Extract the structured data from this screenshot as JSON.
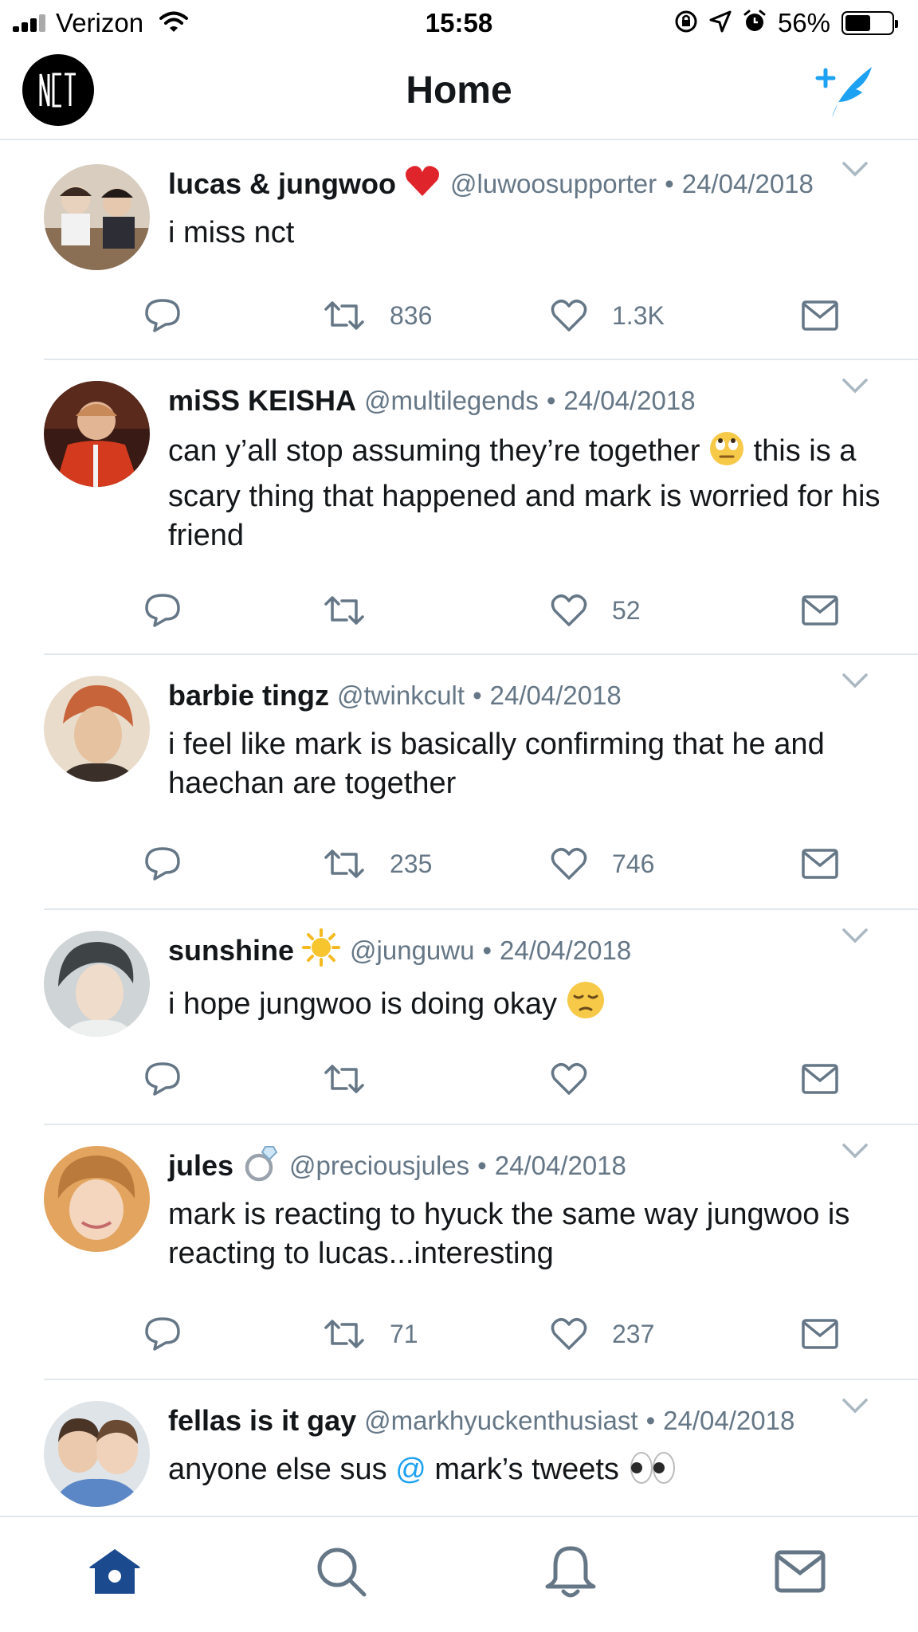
{
  "status_bar": {
    "carrier": "Verizon",
    "time": "15:58",
    "battery_percent": "56%",
    "battery_level": 0.56,
    "icons": [
      "signal-icon",
      "wifi-icon",
      "orientation-lock-icon",
      "location-icon",
      "alarm-icon",
      "battery-icon"
    ]
  },
  "header": {
    "title": "Home",
    "logo_icon": "nct-logo",
    "compose_icon": "compose-tweet-icon"
  },
  "colors": {
    "accent": "#1da1f2",
    "tab_active": "#1c4a8f",
    "icon_gray": "#657786",
    "text": "#14171a",
    "divider": "#e1e8ed",
    "heart_red": "#e0242b"
  },
  "tweets": [
    {
      "name": "lucas & jungwoo",
      "name_emoji": "red-heart-emoji",
      "handle": "@luwoosupporter",
      "separator": "•",
      "date": "24/04/2018",
      "text": "i miss nct",
      "reply_count": "",
      "retweet_count": "836",
      "like_count": "1.3K"
    },
    {
      "name": "miSS KEISHA",
      "handle": "@multilegends",
      "separator": "•",
      "date": "24/04/2018",
      "text_part1": "can y’all stop assuming they’re together",
      "text_emoji": "eye-roll-emoji",
      "text_part2": "this is a scary thing that happened and mark is worried for his friend",
      "reply_count": "",
      "retweet_count": "",
      "like_count": "52"
    },
    {
      "name": "barbie tingz",
      "handle": "@twinkcult",
      "separator": "•",
      "date": "24/04/2018",
      "text": "i feel like mark is basically confirming that he and haechan are together",
      "reply_count": "",
      "retweet_count": "235",
      "like_count": "746"
    },
    {
      "name": "sunshine",
      "name_emoji": "sun-emoji",
      "handle": "@junguwu",
      "separator": "•",
      "date": "24/04/2018",
      "text": "i hope jungwoo is doing okay",
      "text_emoji": "pensive-face-emoji",
      "reply_count": "",
      "retweet_count": "",
      "like_count": ""
    },
    {
      "name": "jules",
      "name_emoji": "ring-emoji",
      "handle": "@preciousjules",
      "separator": "•",
      "date": "24/04/2018",
      "text": "mark is reacting to hyuck the same way jungwoo is reacting to lucas...interesting",
      "reply_count": "",
      "retweet_count": "71",
      "like_count": "237"
    },
    {
      "name": "fellas is it gay",
      "handle": "@markhyuckenthusiast",
      "separator": "•",
      "date": "24/04/2018",
      "text_part1": "anyone else sus",
      "mention": "@",
      "text_part2": "mark’s tweets",
      "text_emoji": "eyes-emoji"
    }
  ],
  "tab_bar": {
    "tabs": [
      "home-icon",
      "search-icon",
      "notifications-icon",
      "messages-icon"
    ],
    "active": "home-icon"
  }
}
